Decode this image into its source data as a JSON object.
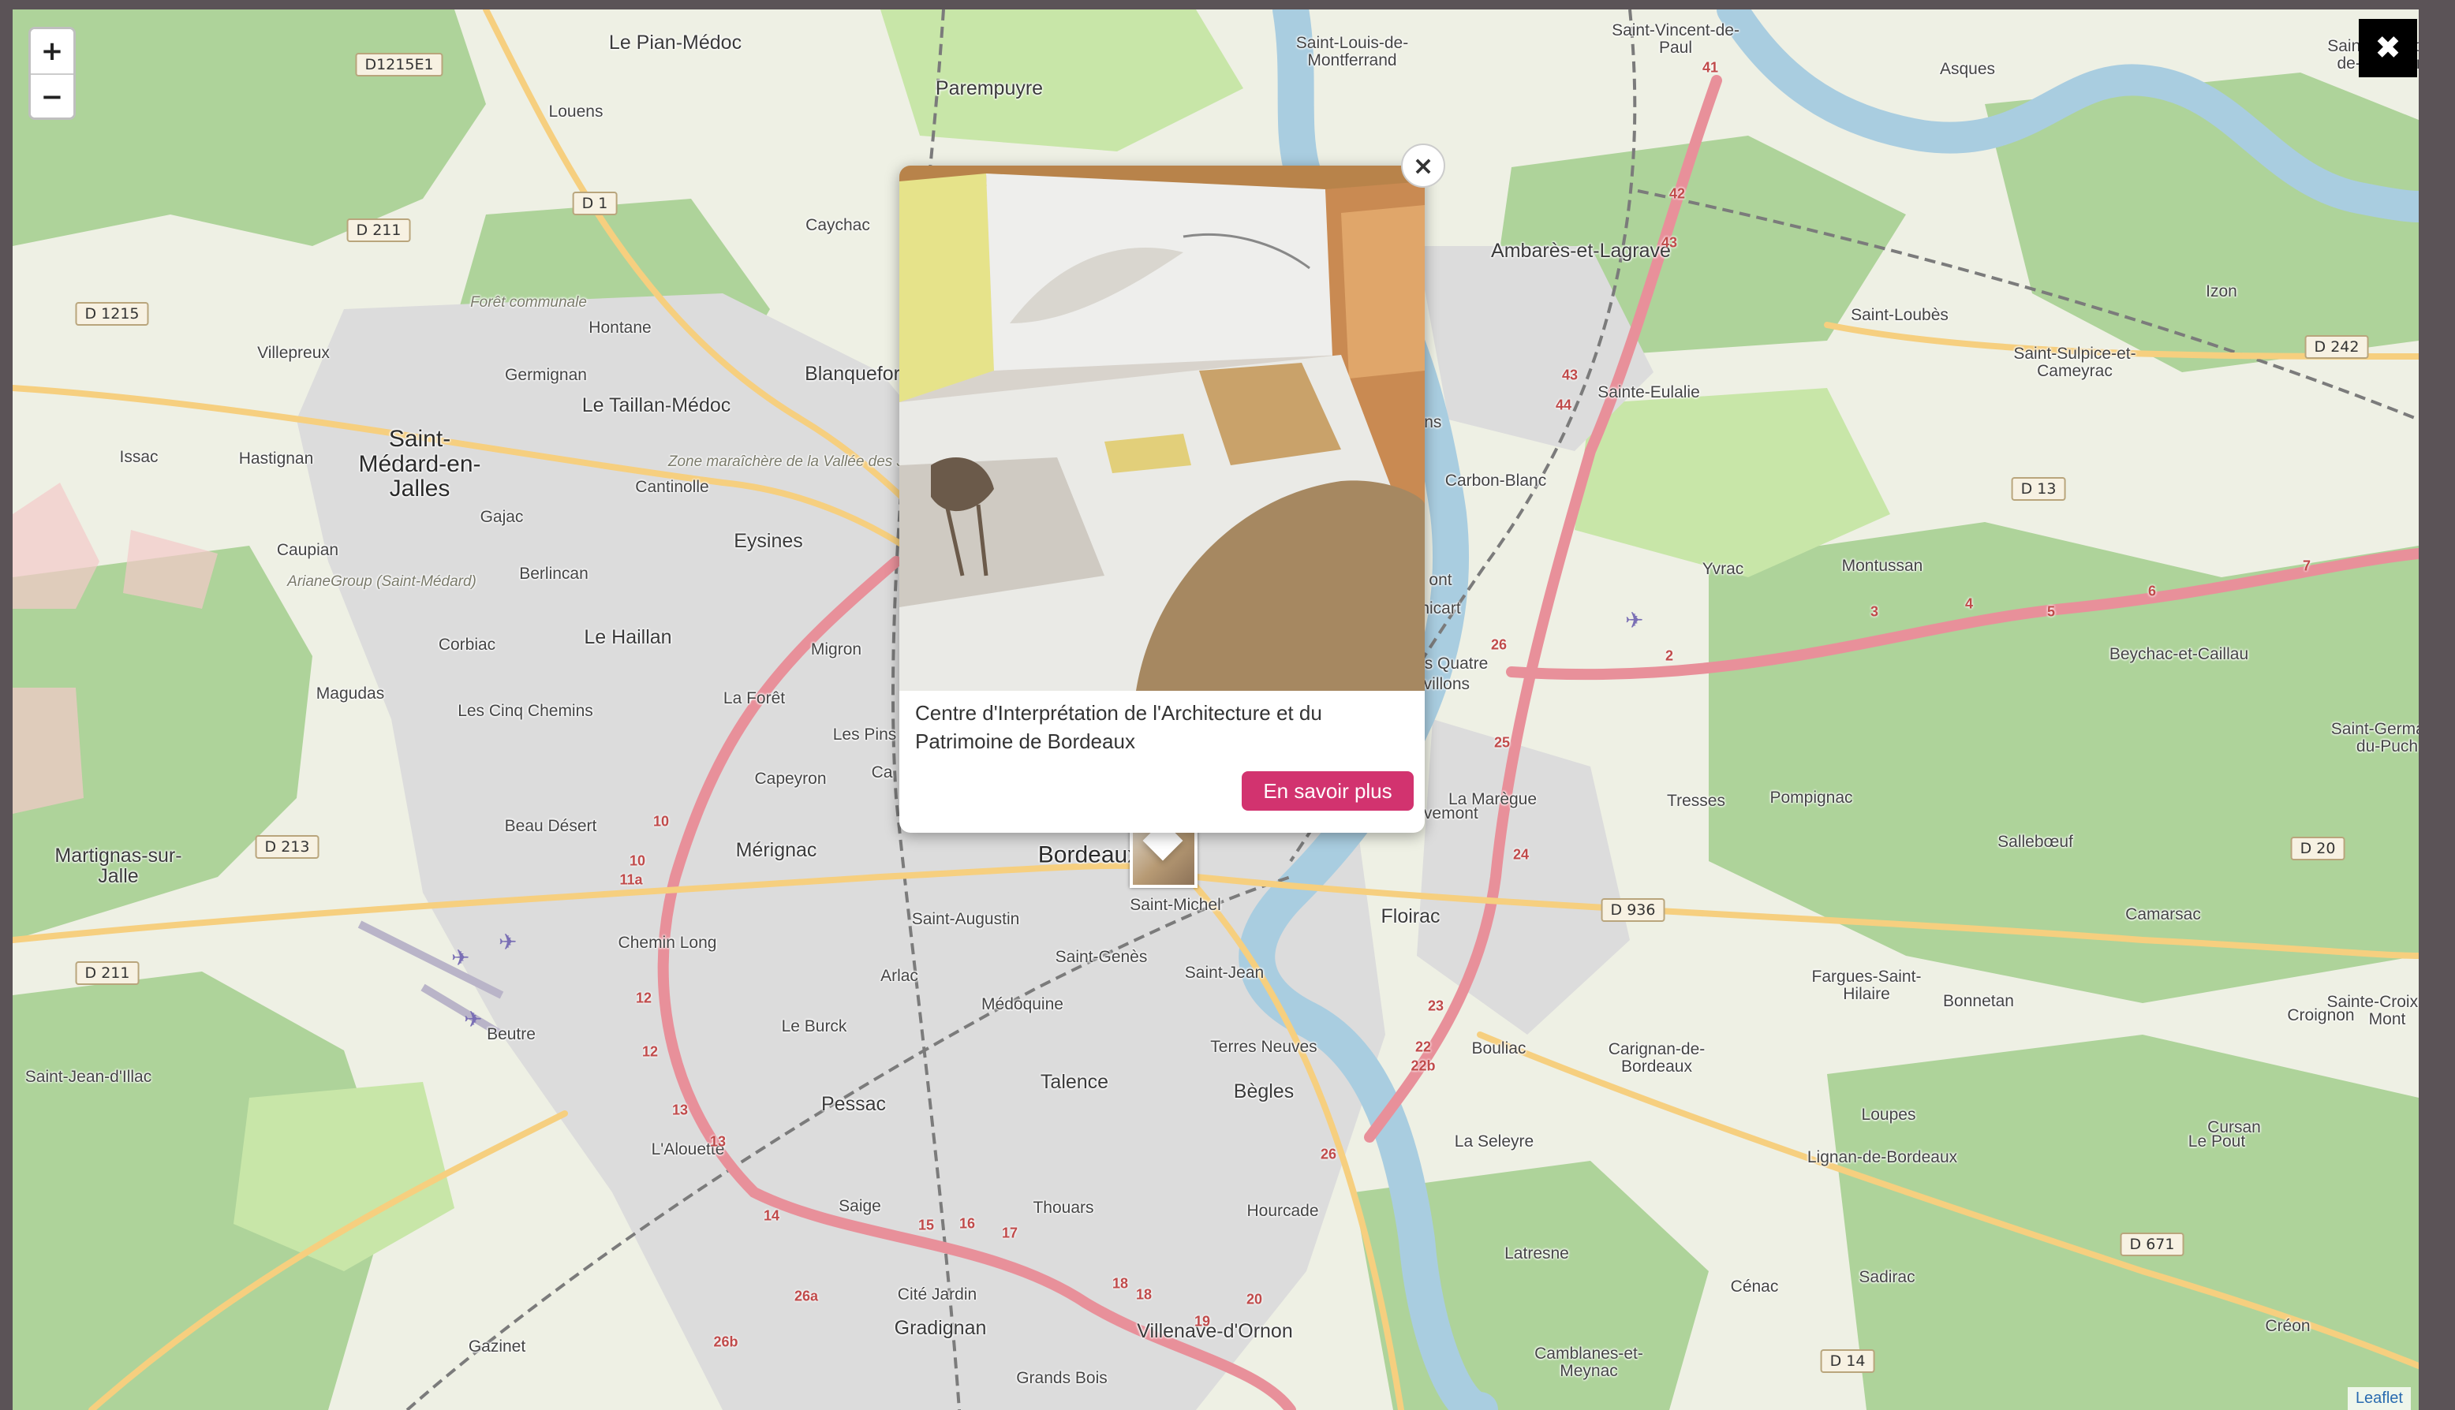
{
  "zoom": {
    "in_label": "+",
    "out_label": "−"
  },
  "lightbox": {
    "close_label": "✖"
  },
  "attribution": "Leaflet",
  "popup": {
    "close_label": "×",
    "title": "Centre d'Interprétation de l'Architecture et du Patrimoine de Bordeaux",
    "button_label": "En savoir plus",
    "button_color": "#d2336f"
  },
  "colors": {
    "water": "#a9cde0",
    "forest": "#aed39a",
    "park": "#c8e6a8",
    "urban": "#dcdcdc",
    "land": "#eef0e4",
    "motorway": "#e8909a",
    "primary": "#f6cf7f",
    "rail": "#7b7b7b"
  },
  "places": [
    {
      "name": "Le Pian-Médoc",
      "cls": "mid"
    },
    {
      "name": "Louens",
      "cls": "small"
    },
    {
      "name": "Parempuyre",
      "cls": "mid"
    },
    {
      "name": "Saint-Louis-de-Montferrand",
      "cls": "small"
    },
    {
      "name": "Saint-Vincent-de-Paul",
      "cls": "small"
    },
    {
      "name": "Asques",
      "cls": "small"
    },
    {
      "name": "Caychac",
      "cls": "small"
    },
    {
      "name": "Ambarès-et-Lagrave",
      "cls": "mid"
    },
    {
      "name": "Forêt communale",
      "cls": "italic"
    },
    {
      "name": "Hontane",
      "cls": "small"
    },
    {
      "name": "Villepreux",
      "cls": "small"
    },
    {
      "name": "Germignan",
      "cls": "small"
    },
    {
      "name": "Blanquefort",
      "cls": "mid"
    },
    {
      "name": "Le Taillan-Médoc",
      "cls": "mid"
    },
    {
      "name": "Saint-Loubès",
      "cls": "small"
    },
    {
      "name": "Izon",
      "cls": "small"
    },
    {
      "name": "Saint-Sulpice-et-Cameyrac",
      "cls": "small"
    },
    {
      "name": "Sainte-Eulalie",
      "cls": "small"
    },
    {
      "name": "Issac",
      "cls": "small"
    },
    {
      "name": "Hastignan",
      "cls": "small"
    },
    {
      "name": "Saint-Médard-en-Jalles",
      "cls": "major"
    },
    {
      "name": "Cantinolle",
      "cls": "small"
    },
    {
      "name": "Zone maraîchère de la Vallée des Jalles",
      "cls": "italic"
    },
    {
      "name": "Carbon-Blanc",
      "cls": "small"
    },
    {
      "name": "Gajac",
      "cls": "small"
    },
    {
      "name": "Eysines",
      "cls": "mid"
    },
    {
      "name": "Caupian",
      "cls": "small"
    },
    {
      "name": "ArianeGroup (Saint-Médard)",
      "cls": "italic"
    },
    {
      "name": "Berlincan",
      "cls": "small"
    },
    {
      "name": "Yvrac",
      "cls": "small"
    },
    {
      "name": "Montussan",
      "cls": "small"
    },
    {
      "name": "Corbiac",
      "cls": "small"
    },
    {
      "name": "Le Haillan",
      "cls": "mid"
    },
    {
      "name": "Migron",
      "cls": "small"
    },
    {
      "name": "Beychac-et-Caillau",
      "cls": "small"
    },
    {
      "name": "Magudas",
      "cls": "small"
    },
    {
      "name": "Les Cinq Chemins",
      "cls": "small"
    },
    {
      "name": "La Forêt",
      "cls": "small"
    },
    {
      "name": "Les Pins",
      "cls": "small"
    },
    {
      "name": "Capeyron",
      "cls": "small"
    },
    {
      "name": "Beau Désert",
      "cls": "small"
    },
    {
      "name": "La Marègue",
      "cls": "small"
    },
    {
      "name": "Tresses",
      "cls": "small"
    },
    {
      "name": "Pompignac",
      "cls": "small"
    },
    {
      "name": "Sallebœuf",
      "cls": "small"
    },
    {
      "name": "Martignas-sur-Jalle",
      "cls": "mid"
    },
    {
      "name": "Mérignac",
      "cls": "mid"
    },
    {
      "name": "Bordeaux",
      "cls": "major"
    },
    {
      "name": "Saint-Michel",
      "cls": "small"
    },
    {
      "name": "Saint-Augustin",
      "cls": "small"
    },
    {
      "name": "Floirac",
      "cls": "mid"
    },
    {
      "name": "Camarsac",
      "cls": "small"
    },
    {
      "name": "Chemin Long",
      "cls": "small"
    },
    {
      "name": "Saint-Genès",
      "cls": "small"
    },
    {
      "name": "Saint-Jean",
      "cls": "small"
    },
    {
      "name": "Fargues-Saint-Hilaire",
      "cls": "small"
    },
    {
      "name": "Bonnetan",
      "cls": "small"
    },
    {
      "name": "Croignon",
      "cls": "small"
    },
    {
      "name": "Arlac",
      "cls": "small"
    },
    {
      "name": "Médoquine",
      "cls": "small"
    },
    {
      "name": "Beutre",
      "cls": "small"
    },
    {
      "name": "Le Burck",
      "cls": "small"
    },
    {
      "name": "Saint-Jean-d'Illac",
      "cls": "small"
    },
    {
      "name": "Terres Neuves",
      "cls": "small"
    },
    {
      "name": "Bouliac",
      "cls": "small"
    },
    {
      "name": "Carignan-de-Bordeaux",
      "cls": "small"
    },
    {
      "name": "Talence",
      "cls": "mid"
    },
    {
      "name": "Bègles",
      "cls": "mid"
    },
    {
      "name": "Pessac",
      "cls": "mid"
    },
    {
      "name": "Loupes",
      "cls": "small"
    },
    {
      "name": "Cursan",
      "cls": "small"
    },
    {
      "name": "L'Alouette",
      "cls": "small"
    },
    {
      "name": "La Seleyre",
      "cls": "small"
    },
    {
      "name": "Lignan-de-Bordeaux",
      "cls": "small"
    },
    {
      "name": "Le Pout",
      "cls": "small"
    },
    {
      "name": "Saige",
      "cls": "small"
    },
    {
      "name": "Thouars",
      "cls": "small"
    },
    {
      "name": "Hourcade",
      "cls": "small"
    },
    {
      "name": "Latresne",
      "cls": "small"
    },
    {
      "name": "Cénac",
      "cls": "small"
    },
    {
      "name": "Sadirac",
      "cls": "small"
    },
    {
      "name": "Cité Jardin",
      "cls": "small"
    },
    {
      "name": "Gradignan",
      "cls": "mid"
    },
    {
      "name": "Villenave-d'Ornon",
      "cls": "mid"
    },
    {
      "name": "Créon",
      "cls": "small"
    },
    {
      "name": "Gazinet",
      "cls": "small"
    },
    {
      "name": "Camblanes-et-Meynac",
      "cls": "small"
    },
    {
      "name": "Grands Bois",
      "cls": "small"
    },
    {
      "name": "Saint-Christoly-de-la-Rivière",
      "cls": "small"
    },
    {
      "name": "Saint-Germain-du-Puch",
      "cls": "small"
    },
    {
      "name": "Sainte-Croix-du-Mont",
      "cls": "small"
    }
  ],
  "partial_places": [
    {
      "name": "ssens"
    },
    {
      "name": "ont"
    },
    {
      "name": "nicart"
    },
    {
      "name": "s Quatre"
    },
    {
      "name": "avillons"
    },
    {
      "name": "ravemont"
    },
    {
      "name": "Ca"
    }
  ],
  "road_shields": [
    {
      "label": "D1215E1"
    },
    {
      "label": "D 1"
    },
    {
      "label": "D 211"
    },
    {
      "label": "D 1215"
    },
    {
      "label": "D 242"
    },
    {
      "label": "D 13"
    },
    {
      "label": "D 213"
    },
    {
      "label": "D 211"
    },
    {
      "label": "D 936"
    },
    {
      "label": "D 20"
    },
    {
      "label": "D 671"
    },
    {
      "label": "D 14"
    }
  ],
  "road_numbers": [
    "10",
    "10",
    "11a",
    "12",
    "12",
    "13",
    "13",
    "14",
    "15",
    "16",
    "17",
    "18",
    "18",
    "19",
    "20",
    "22",
    "22b",
    "23",
    "24",
    "25",
    "26",
    "26",
    "26a",
    "26b",
    "41",
    "42",
    "43",
    "43",
    "44",
    "2",
    "3",
    "4",
    "5",
    "6",
    "7"
  ]
}
